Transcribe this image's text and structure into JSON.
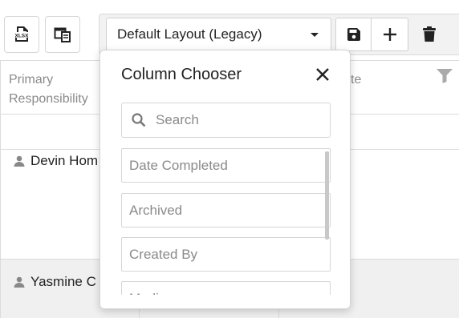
{
  "toolbar": {
    "export_xlsx_icon": "xlsx-export-icon",
    "export_xlsx_text": "XLSX",
    "column_chooser_icon": "column-chooser-icon",
    "layout_select_value": "Default Layout (Legacy)",
    "save_icon": "save-icon",
    "add_icon": "plus-icon",
    "delete_icon": "trash-icon"
  },
  "grid": {
    "headers": [
      "Primary Responsibility",
      "te"
    ],
    "rows": [
      {
        "name": "Devin Hom"
      },
      {
        "name": "Yasmine C"
      }
    ]
  },
  "column_chooser": {
    "title": "Column Chooser",
    "close_icon": "close-icon",
    "search_placeholder": "Search",
    "items": [
      "Date Completed",
      "Archived",
      "Created By",
      "Modi..."
    ]
  },
  "colors": {
    "border": "#d6d6d6",
    "row_alt": "#f0f0f0",
    "toolbar_bg": "#f2f2f2",
    "muted_text": "#8a8a8a"
  }
}
